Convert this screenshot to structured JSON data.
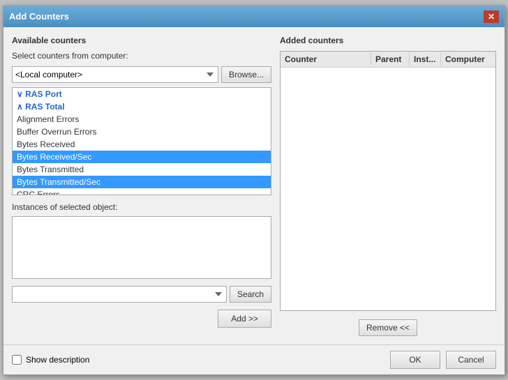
{
  "dialog": {
    "title": "Add Counters",
    "close_label": "✕"
  },
  "left_panel": {
    "label": "Available counters",
    "select_label": "Select counters from computer:",
    "computer_value": "<Local computer>",
    "browse_label": "Browse...",
    "counters": [
      {
        "id": "ras-port",
        "text": "RAS Port",
        "type": "category",
        "selected": false,
        "expanded": false
      },
      {
        "id": "ras-total",
        "text": "RAS Total",
        "type": "category",
        "selected": false,
        "expanded": true
      },
      {
        "id": "alignment-errors",
        "text": "Alignment Errors",
        "type": "item",
        "selected": false
      },
      {
        "id": "buffer-overrun-errors",
        "text": "Buffer Overrun Errors",
        "type": "item",
        "selected": false
      },
      {
        "id": "bytes-received",
        "text": "Bytes Received",
        "type": "item",
        "selected": false
      },
      {
        "id": "bytes-received-sec",
        "text": "Bytes Received/Sec",
        "type": "item",
        "selected": true
      },
      {
        "id": "bytes-transmitted",
        "text": "Bytes Transmitted",
        "type": "item",
        "selected": false
      },
      {
        "id": "bytes-transmitted-sec",
        "text": "Bytes Transmitted/Sec",
        "type": "item",
        "selected": true
      },
      {
        "id": "crc-errors",
        "text": "CRC Errors",
        "type": "item",
        "selected": false
      }
    ],
    "instances_label": "Instances of selected object:",
    "search_placeholder": "",
    "search_label": "Search",
    "add_label": "Add >>"
  },
  "right_panel": {
    "label": "Added counters",
    "columns": [
      {
        "id": "counter",
        "text": "Counter"
      },
      {
        "id": "parent",
        "text": "Parent"
      },
      {
        "id": "inst",
        "text": "Inst..."
      },
      {
        "id": "computer",
        "text": "Computer"
      }
    ],
    "rows": [],
    "remove_label": "Remove <<"
  },
  "footer": {
    "show_description_label": "Show description",
    "ok_label": "OK",
    "cancel_label": "Cancel"
  }
}
